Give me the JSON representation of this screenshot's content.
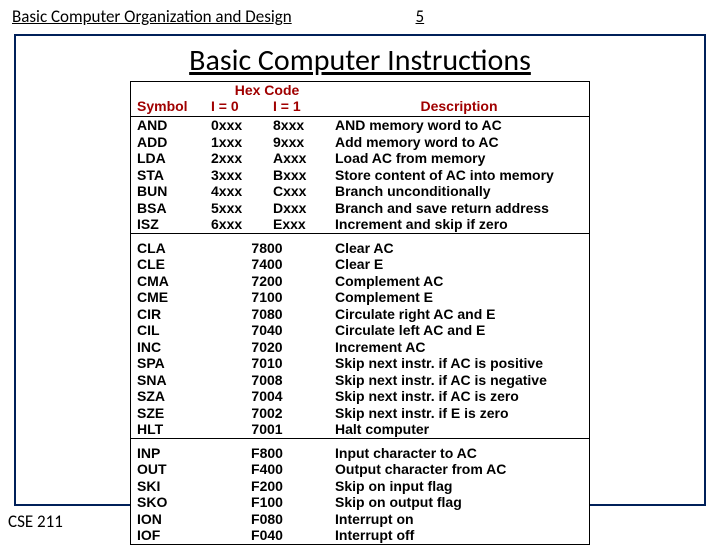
{
  "header": {
    "title": "Basic Computer Organization and Design",
    "page_num": "5"
  },
  "footer": {
    "course": "CSE 211"
  },
  "slide_title": "Basic  Computer  Instructions",
  "table": {
    "hex_header": "Hex Code",
    "col_symbol": "Symbol",
    "col_i0": "I = 0",
    "col_i1": "I = 1",
    "col_desc": "Description",
    "group1": [
      {
        "sym": "AND",
        "i0": "0xxx",
        "i1": "8xxx",
        "desc": "AND memory word to AC"
      },
      {
        "sym": "ADD",
        "i0": "1xxx",
        "i1": "9xxx",
        "desc": "Add memory word to AC"
      },
      {
        "sym": "LDA",
        "i0": "2xxx",
        "i1": "Axxx",
        "desc": "Load AC from memory"
      },
      {
        "sym": "STA",
        "i0": "3xxx",
        "i1": "Bxxx",
        "desc": "Store content of AC into memory"
      },
      {
        "sym": "BUN",
        "i0": "4xxx",
        "i1": "Cxxx",
        "desc": "Branch unconditionally"
      },
      {
        "sym": "BSA",
        "i0": "5xxx",
        "i1": "Dxxx",
        "desc": "Branch and save return address"
      },
      {
        "sym": "ISZ",
        "i0": "6xxx",
        "i1": "Exxx",
        "desc": "Increment and skip if zero"
      }
    ],
    "group2": [
      {
        "sym": "CLA",
        "hx": "7800",
        "desc": "Clear AC"
      },
      {
        "sym": "CLE",
        "hx": "7400",
        "desc": "Clear E"
      },
      {
        "sym": "CMA",
        "hx": "7200",
        "desc": "Complement AC"
      },
      {
        "sym": "CME",
        "hx": "7100",
        "desc": "Complement E"
      },
      {
        "sym": "CIR",
        "hx": "7080",
        "desc": "Circulate right AC and E"
      },
      {
        "sym": "CIL",
        "hx": "7040",
        "desc": "Circulate left AC and E"
      },
      {
        "sym": "INC",
        "hx": "7020",
        "desc": "Increment AC"
      },
      {
        "sym": "SPA",
        "hx": "7010",
        "desc": "Skip next instr. if AC is positive"
      },
      {
        "sym": "SNA",
        "hx": "7008",
        "desc": "Skip next instr. if AC is negative"
      },
      {
        "sym": "SZA",
        "hx": "7004",
        "desc": "Skip next instr. if AC is zero"
      },
      {
        "sym": "SZE",
        "hx": "7002",
        "desc": "Skip next instr. if E is zero"
      },
      {
        "sym": "HLT",
        "hx": "7001",
        "desc": "Halt computer"
      }
    ],
    "group3": [
      {
        "sym": "INP",
        "hx": "F800",
        "desc": "Input character to AC"
      },
      {
        "sym": "OUT",
        "hx": "F400",
        "desc": "Output character from AC"
      },
      {
        "sym": "SKI",
        "hx": "F200",
        "desc": "Skip on input flag"
      },
      {
        "sym": "SKO",
        "hx": "F100",
        "desc": "Skip on output flag"
      },
      {
        "sym": "ION",
        "hx": "F080",
        "desc": "Interrupt on"
      },
      {
        "sym": "IOF",
        "hx": "F040",
        "desc": "Interrupt off"
      }
    ]
  }
}
